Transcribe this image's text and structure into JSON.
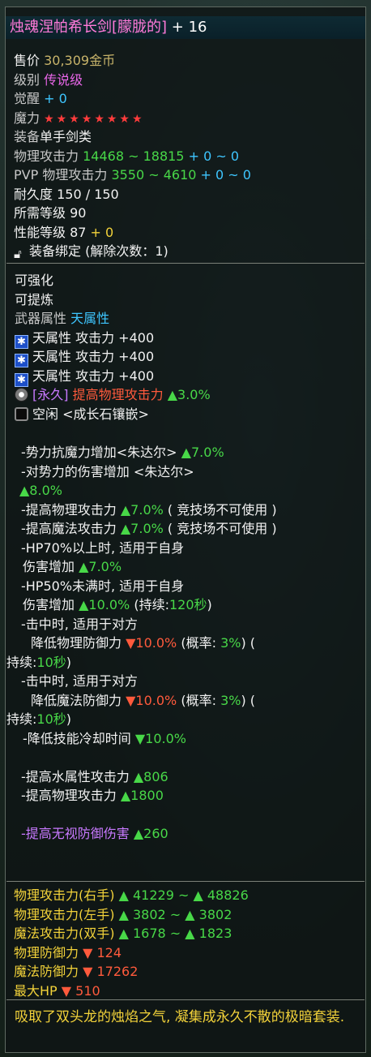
{
  "item": {
    "name": "烛魂涅帕希长剑[朦胧的]",
    "plus": "+ 16"
  },
  "basic": {
    "price_label": "售价",
    "price_value": "30,309金币",
    "grade_label": "级别",
    "grade_value": "传说级",
    "awaken_label": "觉醒",
    "awaken_value": "+ 0",
    "magic_label": "魔力",
    "magic_stars": "★★★★★★★★",
    "equip_label": "装备",
    "equip_value": "单手剑类",
    "patk_label": "物理攻击力",
    "patk_range": "14468 ~ 18815",
    "patk_bonus": "+ 0 ~ 0",
    "pvp_label": "PVP 物理攻击力",
    "pvp_range": "3550 ~ 4610",
    "pvp_bonus": "+ 0 ~ 0",
    "durability": "耐久度 150 / 150",
    "req_level": "所需等级 90",
    "perf_label": "性能等级 87",
    "perf_bonus": "+ 0",
    "bind": "装备绑定 (解除次数：1)"
  },
  "enhance": {
    "can_enhance": "可强化",
    "can_refine": "可提炼",
    "attr_label": "武器属性",
    "attr_value": "天属性",
    "sky_attack": [
      "天属性 攻击力 +400",
      "天属性 攻击力 +400",
      "天属性 攻击力 +400"
    ],
    "perm_tag": "[永久]",
    "perm_text": "提高物理攻击力",
    "perm_value": "▲3.0%",
    "slot_text": "空闲 <成长石镶嵌>"
  },
  "options": {
    "opt1_text": "-势力抗魔力增加<朱达尔>",
    "opt1_value": "▲7.0%",
    "opt2_text": "-对势力的伤害增加 <朱达尔>",
    "opt2_value": "▲8.0%",
    "opt3_text": "-提高物理攻击力",
    "opt3_value": "▲7.0%",
    "opt3_note": "( 竞技场不可使用 )",
    "opt4_text": "-提高魔法攻击力",
    "opt4_value": "▲7.0%",
    "opt4_note": "( 竞技场不可使用 )",
    "opt5_line1": "-HP70%以上时, 适用于自身",
    "opt5_line2": "伤害增加",
    "opt5_value": "▲7.0%",
    "opt6_line1": "-HP50%未满时, 适用于自身",
    "opt6_line2": "伤害增加",
    "opt6_value": "▲10.0%",
    "opt6_dur_label": "(持续:",
    "opt6_dur_value": "120秒",
    "opt6_dur_end": ")",
    "opt7_line1": "-击中时, 适用于对方",
    "opt7_line2": "降低物理防御力",
    "opt7_value": "▼10.0%",
    "opt7_prob_label": "(概率:",
    "opt7_prob_value": "3%",
    "opt7_prob_end": ") (",
    "opt7_dur_label": "持续:",
    "opt7_dur_value": "10秒",
    "opt7_dur_end": ")",
    "opt8_line1": "-击中时, 适用于对方",
    "opt8_line2": "降低魔法防御力",
    "opt8_value": "▼10.0%",
    "opt8_prob_label": "(概率:",
    "opt8_prob_value": "3%",
    "opt8_prob_end": ") (",
    "opt8_dur_label": "持续:",
    "opt8_dur_value": "10秒",
    "opt8_dur_end": ")",
    "opt9_text": "-降低技能冷却时间",
    "opt9_value": "▼10.0%",
    "opt10_text": "-提高水属性攻击力",
    "opt10_value": "▲806",
    "opt11_text": "-提高物理攻击力",
    "opt11_value": "▲1800",
    "opt12_text": "-提高无视防御伤害",
    "opt12_value": "▲260"
  },
  "compare": {
    "right_label": "物理攻击力(右手)",
    "right_value": "▲ 41229 ~ ▲ 48826",
    "left_label": "物理攻击力(左手)",
    "left_value": "▲ 3802 ~ ▲ 3802",
    "magic_label": "魔法攻击力(双手)",
    "magic_value": "▲ 1678 ~ ▲ 1823",
    "pdef_label": "物理防御力",
    "pdef_value": "▼ 124",
    "mdef_label": "魔法防御力",
    "mdef_value": "▼ 17262",
    "hp_label": "最大HP",
    "hp_value": "▼ 510"
  },
  "description": "吸取了双头龙的烛焰之气, 凝集成永久不散的极暗套装."
}
